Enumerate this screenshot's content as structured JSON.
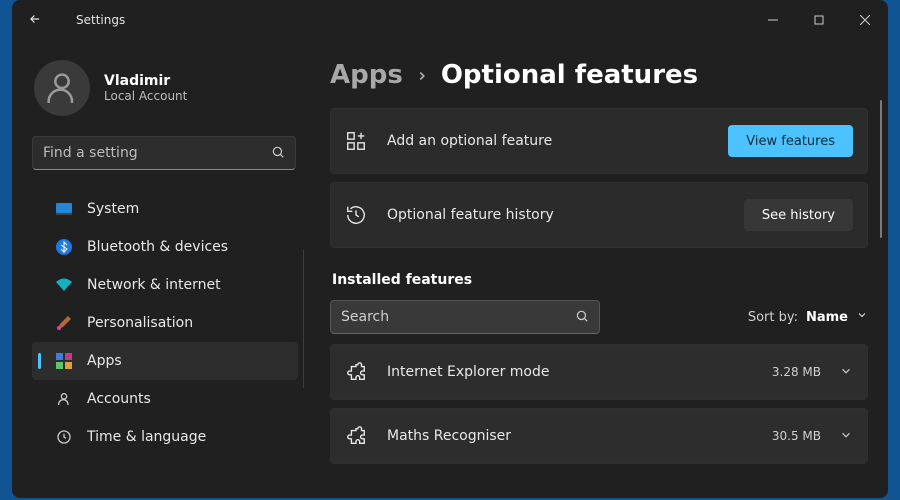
{
  "window": {
    "app_title": "Settings"
  },
  "user": {
    "name": "Vladimir",
    "account_type": "Local Account"
  },
  "sidebar_search": {
    "placeholder": "Find a setting"
  },
  "nav": {
    "items": [
      {
        "label": "System"
      },
      {
        "label": "Bluetooth & devices"
      },
      {
        "label": "Network & internet"
      },
      {
        "label": "Personalisation"
      },
      {
        "label": "Apps",
        "selected": true
      },
      {
        "label": "Accounts"
      },
      {
        "label": "Time & language"
      }
    ]
  },
  "breadcrumb": {
    "parent": "Apps",
    "title": "Optional features"
  },
  "cards": {
    "add": {
      "label": "Add an optional feature",
      "button": "View features"
    },
    "history": {
      "label": "Optional feature history",
      "button": "See history"
    }
  },
  "installed": {
    "heading": "Installed features",
    "search_placeholder": "Search",
    "sort_label": "Sort by:",
    "sort_value": "Name",
    "items": [
      {
        "name": "Internet Explorer mode",
        "size": "3.28 MB"
      },
      {
        "name": "Maths Recogniser",
        "size": "30.5 MB"
      }
    ]
  },
  "colors": {
    "accent": "#4cc2ff"
  }
}
